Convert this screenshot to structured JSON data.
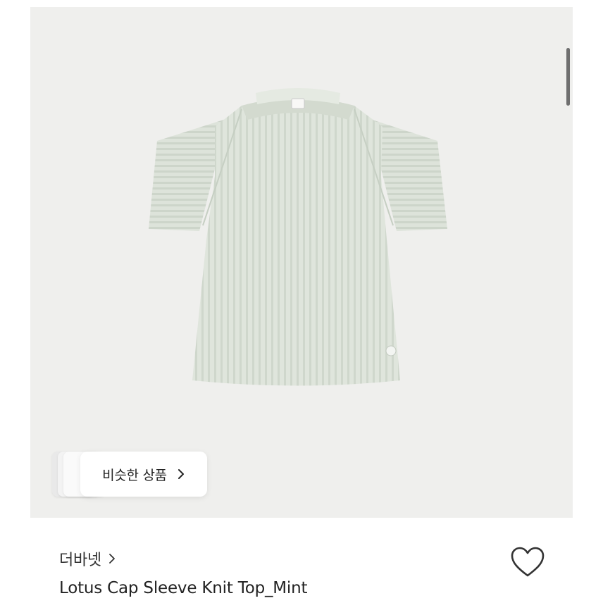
{
  "similar_products": {
    "label": "비슷한 상품"
  },
  "brand": {
    "name": "더바넷"
  },
  "product": {
    "title": "Lotus Cap Sleeve Knit Top_Mint",
    "image_subject": "mint ribbed knit cap sleeve top",
    "liked": false
  },
  "colors": {
    "image_background": "#efefed",
    "garment": "#dfe5dc",
    "text_primary": "#222222"
  },
  "icons": {
    "similar_chevron": "chevron-right-icon",
    "brand_chevron": "chevron-right-icon",
    "like": "heart-outline-icon"
  }
}
